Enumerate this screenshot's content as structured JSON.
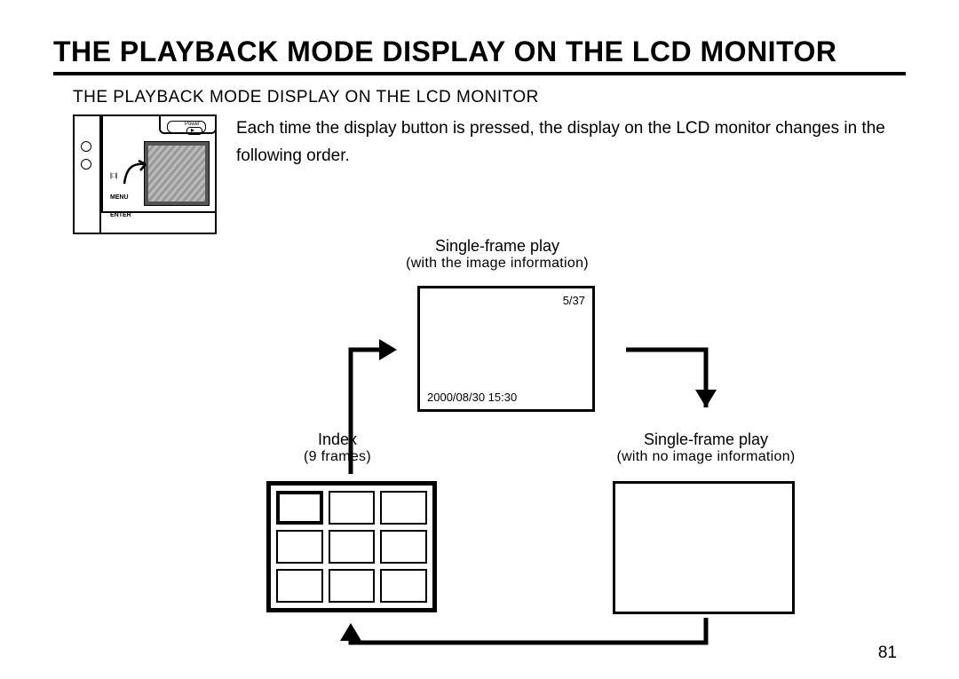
{
  "title": "THE PLAYBACK MODE DISPLAY ON THE LCD MONITOR",
  "subtitle": "THE PLAYBACK MODE DISPLAY ON THE LCD MONITOR",
  "intro": "Each time the display button is pressed, the display on the LCD monitor changes in the following order.",
  "camera": {
    "power_label": "Power",
    "disp_label": "",
    "menu_label": "MENU",
    "enter_label": "ENTER"
  },
  "modes": {
    "single_with_info": {
      "title": "Single-frame play",
      "subtitle": "(with the image information)",
      "frame_counter": "5/37",
      "datetime": "2000/08/30 15:30"
    },
    "single_no_info": {
      "title": "Single-frame play",
      "subtitle": "(with no image information)"
    },
    "index": {
      "title": "Index",
      "subtitle": "(9 frames)"
    }
  },
  "page_number": "81"
}
